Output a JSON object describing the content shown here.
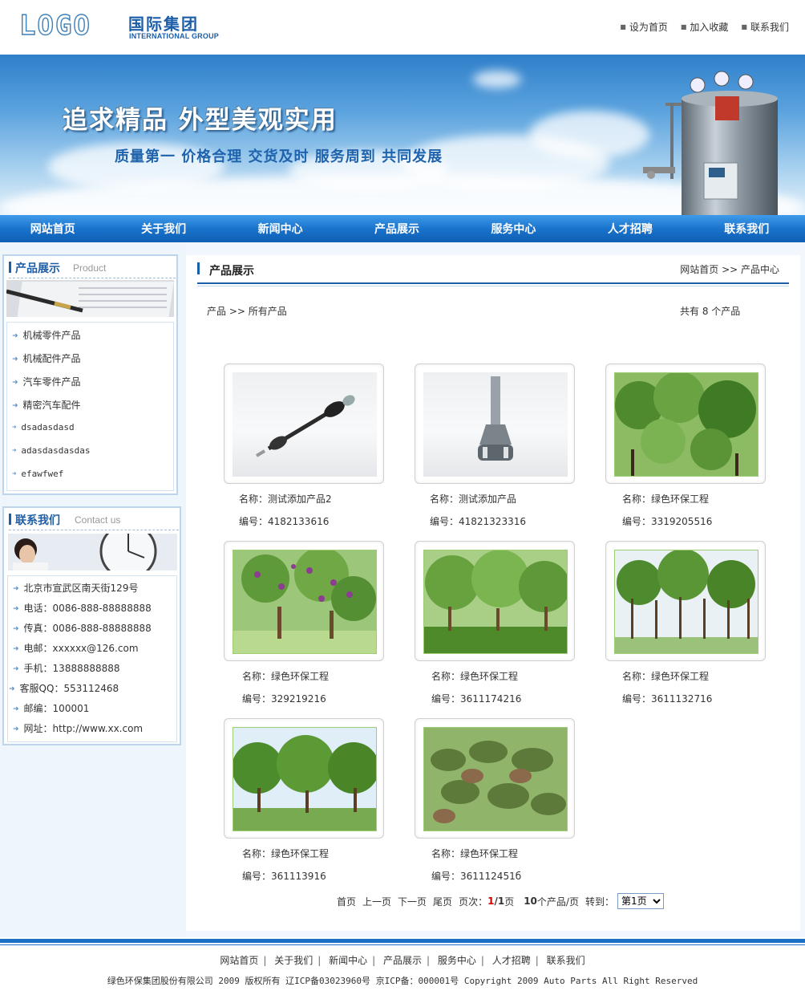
{
  "header": {
    "logo_text": "LOGO",
    "company_cn": "国际集团",
    "company_en": "INTERNATIONAL GROUP",
    "top_links": [
      "设为首页",
      "加入收藏",
      "联系我们"
    ]
  },
  "banner": {
    "headline": "追求精品  外型美观实用",
    "subline": "质量第一 价格合理 交货及时 服务周到 共同发展"
  },
  "nav": [
    "网站首页",
    "关于我们",
    "新闻中心",
    "产品展示",
    "服务中心",
    "人才招聘",
    "联系我们"
  ],
  "sidebar": {
    "product_box": {
      "title_cn": "产品展示",
      "title_en": "Product",
      "items": [
        "机械零件产品",
        "机械配件产品",
        "汽车零件产品",
        "精密汽车配件",
        "dsadasdasd",
        "adasdasdasdas",
        "efawfwef"
      ]
    },
    "contact_box": {
      "title_cn": "联系我们",
      "title_en": "Contact us",
      "items": [
        "北京市宣武区南天街129号",
        "电话：0086-888-88888888",
        "传真：0086-888-88888888",
        "电邮：xxxxxx@126.com",
        "手机：13888888888",
        "客服QQ：553112468",
        "邮编：100001",
        "网址：http://www.xx.com"
      ]
    }
  },
  "main": {
    "title": "产品展示",
    "breadcrumb": "网站首页 >> 产品中心",
    "sub_breadcrumb": "产品 >> 所有产品",
    "count_text": "共有 8 个产品",
    "products": [
      {
        "name": "名称：测试添加产品2",
        "code": "编号：4182133616",
        "image": "axle-shaft"
      },
      {
        "name": "名称：测试添加产品",
        "code": "编号：41821323316",
        "image": "cv-joint"
      },
      {
        "name": "名称：绿色环保工程",
        "code": "编号：3319205516",
        "image": "green-leaves"
      },
      {
        "name": "名称：绿色环保工程",
        "code": "编号：329219216",
        "image": "purple-flower-tree"
      },
      {
        "name": "名称：绿色环保工程",
        "code": "编号：3611174216",
        "image": "willow-trees"
      },
      {
        "name": "名称：绿色环保工程",
        "code": "编号：3611132716",
        "image": "tree-grove"
      },
      {
        "name": "名称：绿色环保工程",
        "code": "编号：361113916",
        "image": "tree-row"
      },
      {
        "name": "名称：绿色环保工程",
        "code": "编号：361112451б",
        "image": "dense-leaves"
      }
    ],
    "pager": {
      "first": "首页",
      "prev": "上一页",
      "next": "下一页",
      "last": "尾页",
      "page_label": "页次：",
      "current": "1",
      "slash": "/",
      "total": "1",
      "page_suffix": "页",
      "per_page": "10",
      "per_page_suffix": "个产品/页",
      "goto": "转到：",
      "select_value": "第1页"
    }
  },
  "footer": {
    "links": [
      "网站首页",
      "关于我们",
      "新闻中心",
      "产品展示",
      "服务中心",
      "人才招聘",
      "联系我们"
    ],
    "copyright": "绿色环保集团股份有限公司 2009 版权所有 辽ICP备03023960号 京ICP备：000001号 Copyright 2009 Auto Parts All Right Reserved"
  },
  "colors": {
    "brand_blue": "#1d5ea8",
    "nav_blue": "#1a73cc",
    "sidebar_border": "#bcd5ec",
    "pager_red": "#cc0000"
  }
}
